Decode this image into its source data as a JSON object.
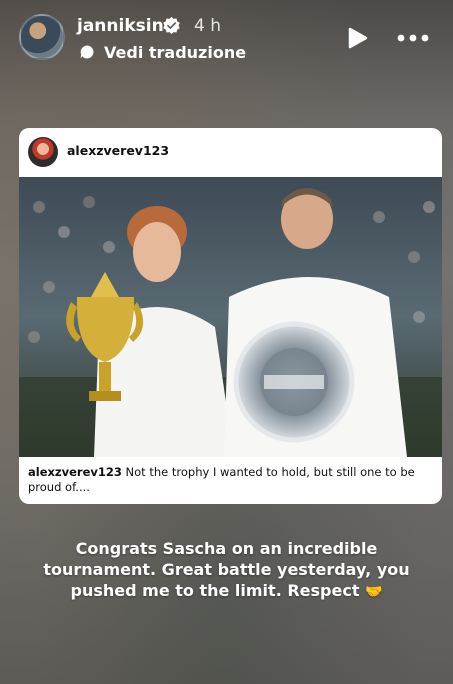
{
  "header": {
    "username": "janniksin",
    "time": "4 h",
    "translate_label": "Vedi traduzione"
  },
  "card": {
    "username": "alexzverev123",
    "caption_user": "alexzverev123",
    "caption_text": "Not the trophy I wanted to hold, but still one to be proud of...."
  },
  "story": {
    "text": "Congrats Sascha on an incredible tournament. Great battle yesterday, you pushed me to the limit. Respect",
    "emoji": "🤝"
  },
  "colors": {
    "accent_white": "#ffffff",
    "card_bg": "#ffffff"
  }
}
